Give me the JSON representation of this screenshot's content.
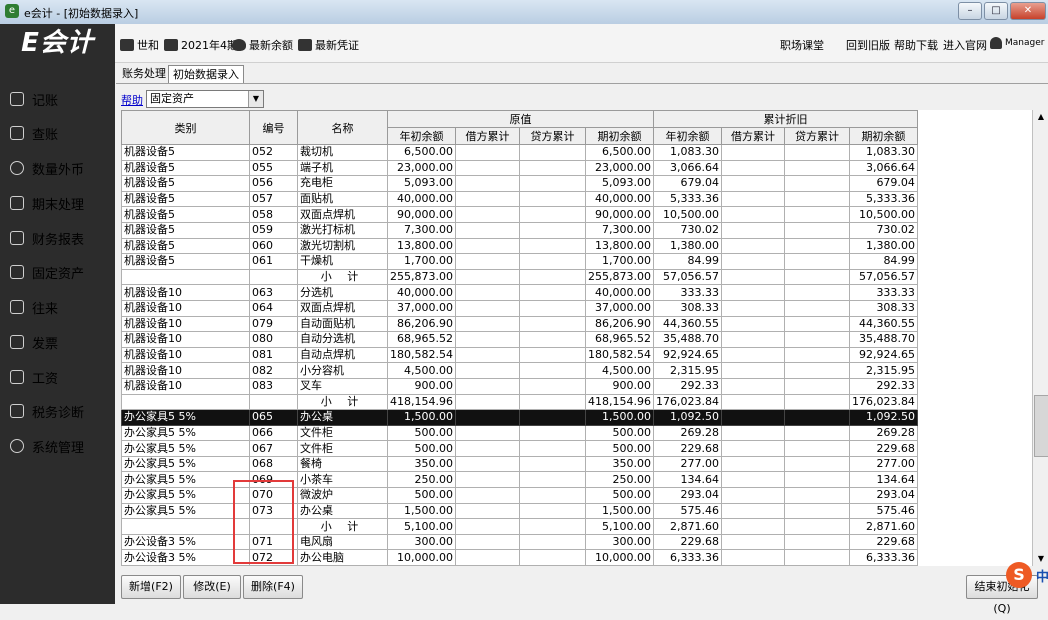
{
  "window": {
    "title": "e会计 - [初始数据录入]",
    "minimize": "–",
    "restore": "□",
    "close": "✕"
  },
  "logo": {
    "text": "E会计"
  },
  "toolbar": {
    "items": [
      {
        "icon": "camera-icon",
        "label": "世和"
      },
      {
        "icon": "calendar-icon",
        "label": "2021年4期"
      },
      {
        "icon": "moneybag-icon",
        "label": "最新余额"
      },
      {
        "icon": "voucher-icon",
        "label": "最新凭证"
      }
    ],
    "right": [
      {
        "label": "职场课堂"
      },
      {
        "label": "回到旧版"
      },
      {
        "label": "帮助下载"
      },
      {
        "label": "进入官网"
      },
      {
        "label": "Manager"
      }
    ]
  },
  "sidebar": {
    "items": [
      {
        "label": "记账"
      },
      {
        "label": "查账"
      },
      {
        "label": "数量外币"
      },
      {
        "label": "期末处理"
      },
      {
        "label": "财务报表"
      },
      {
        "label": "固定资产"
      },
      {
        "label": "往来"
      },
      {
        "label": "发票"
      },
      {
        "label": "工资"
      },
      {
        "label": "税务诊断"
      },
      {
        "label": "系统管理"
      }
    ]
  },
  "tabs": [
    {
      "label": "账务处理"
    },
    {
      "label": "初始数据录入"
    }
  ],
  "helpbar": {
    "help_link": "帮助",
    "selected": "固定资产"
  },
  "grid": {
    "headers": {
      "category": "类别",
      "code": "编号",
      "name": "名称",
      "orig_group": "原值",
      "dep_group": "累计折旧",
      "sub": [
        "年初余额",
        "借方累计",
        "贷方累计",
        "期初余额",
        "年初余额",
        "借方累计",
        "贷方累计",
        "期初余额"
      ]
    },
    "rows": [
      [
        "机器设备5",
        "052",
        "裁切机",
        "6,500.00",
        "",
        "",
        "6,500.00",
        "1,083.30",
        "",
        "",
        "1,083.30"
      ],
      [
        "机器设备5",
        "055",
        "端子机",
        "23,000.00",
        "",
        "",
        "23,000.00",
        "3,066.64",
        "",
        "",
        "3,066.64"
      ],
      [
        "机器设备5",
        "056",
        "充电柜",
        "5,093.00",
        "",
        "",
        "5,093.00",
        "679.04",
        "",
        "",
        "679.04"
      ],
      [
        "机器设备5",
        "057",
        "面贴机",
        "40,000.00",
        "",
        "",
        "40,000.00",
        "5,333.36",
        "",
        "",
        "5,333.36"
      ],
      [
        "机器设备5",
        "058",
        "双面点焊机",
        "90,000.00",
        "",
        "",
        "90,000.00",
        "10,500.00",
        "",
        "",
        "10,500.00"
      ],
      [
        "机器设备5",
        "059",
        "激光打标机",
        "7,300.00",
        "",
        "",
        "7,300.00",
        "730.02",
        "",
        "",
        "730.02"
      ],
      [
        "机器设备5",
        "060",
        "激光切割机",
        "13,800.00",
        "",
        "",
        "13,800.00",
        "1,380.00",
        "",
        "",
        "1,380.00"
      ],
      [
        "机器设备5",
        "061",
        "干燥机",
        "1,700.00",
        "",
        "",
        "1,700.00",
        "84.99",
        "",
        "",
        "84.99"
      ],
      [
        "",
        "",
        "小 计",
        "255,873.00",
        "",
        "",
        "255,873.00",
        "57,056.57",
        "",
        "",
        "57,056.57"
      ],
      [
        "机器设备10",
        "063",
        "分选机",
        "40,000.00",
        "",
        "",
        "40,000.00",
        "333.33",
        "",
        "",
        "333.33"
      ],
      [
        "机器设备10",
        "064",
        "双面点焊机",
        "37,000.00",
        "",
        "",
        "37,000.00",
        "308.33",
        "",
        "",
        "308.33"
      ],
      [
        "机器设备10",
        "079",
        "自动面贴机",
        "86,206.90",
        "",
        "",
        "86,206.90",
        "44,360.55",
        "",
        "",
        "44,360.55"
      ],
      [
        "机器设备10",
        "080",
        "自动分选机",
        "68,965.52",
        "",
        "",
        "68,965.52",
        "35,488.70",
        "",
        "",
        "35,488.70"
      ],
      [
        "机器设备10",
        "081",
        "自动点焊机",
        "180,582.54",
        "",
        "",
        "180,582.54",
        "92,924.65",
        "",
        "",
        "92,924.65"
      ],
      [
        "机器设备10",
        "082",
        "小分容机",
        "4,500.00",
        "",
        "",
        "4,500.00",
        "2,315.95",
        "",
        "",
        "2,315.95"
      ],
      [
        "机器设备10",
        "083",
        "叉车",
        "900.00",
        "",
        "",
        "900.00",
        "292.33",
        "",
        "",
        "292.33"
      ],
      [
        "",
        "",
        "小 计",
        "418,154.96",
        "",
        "",
        "418,154.96",
        "176,023.84",
        "",
        "",
        "176,023.84"
      ],
      [
        "办公家具5 5%",
        "065",
        "办公桌",
        "1,500.00",
        "",
        "",
        "1,500.00",
        "1,092.50",
        "",
        "",
        "1,092.50"
      ],
      [
        "办公家具5 5%",
        "066",
        "文件柜",
        "500.00",
        "",
        "",
        "500.00",
        "269.28",
        "",
        "",
        "269.28"
      ],
      [
        "办公家具5 5%",
        "067",
        "文件柜",
        "500.00",
        "",
        "",
        "500.00",
        "229.68",
        "",
        "",
        "229.68"
      ],
      [
        "办公家具5 5%",
        "068",
        "餐椅",
        "350.00",
        "",
        "",
        "350.00",
        "277.00",
        "",
        "",
        "277.00"
      ],
      [
        "办公家具5 5%",
        "069",
        "小茶车",
        "250.00",
        "",
        "",
        "250.00",
        "134.64",
        "",
        "",
        "134.64"
      ],
      [
        "办公家具5 5%",
        "070",
        "微波炉",
        "500.00",
        "",
        "",
        "500.00",
        "293.04",
        "",
        "",
        "293.04"
      ],
      [
        "办公家具5 5%",
        "073",
        "办公桌",
        "1,500.00",
        "",
        "",
        "1,500.00",
        "575.46",
        "",
        "",
        "575.46"
      ],
      [
        "",
        "",
        "小 计",
        "5,100.00",
        "",
        "",
        "5,100.00",
        "2,871.60",
        "",
        "",
        "2,871.60"
      ],
      [
        "办公设备3 5%",
        "071",
        "电风扇",
        "300.00",
        "",
        "",
        "300.00",
        "229.68",
        "",
        "",
        "229.68"
      ],
      [
        "办公设备3 5%",
        "072",
        "办公电脑",
        "10,000.00",
        "",
        "",
        "10,000.00",
        "6,333.36",
        "",
        "",
        "6,333.36"
      ]
    ]
  },
  "buttons": {
    "add": "新增(F2)",
    "edit": "修改(E)",
    "delete": "删除(F4)",
    "finish": "结束初始化(Q)"
  },
  "ime": {
    "badge": "S",
    "lang": "中"
  }
}
